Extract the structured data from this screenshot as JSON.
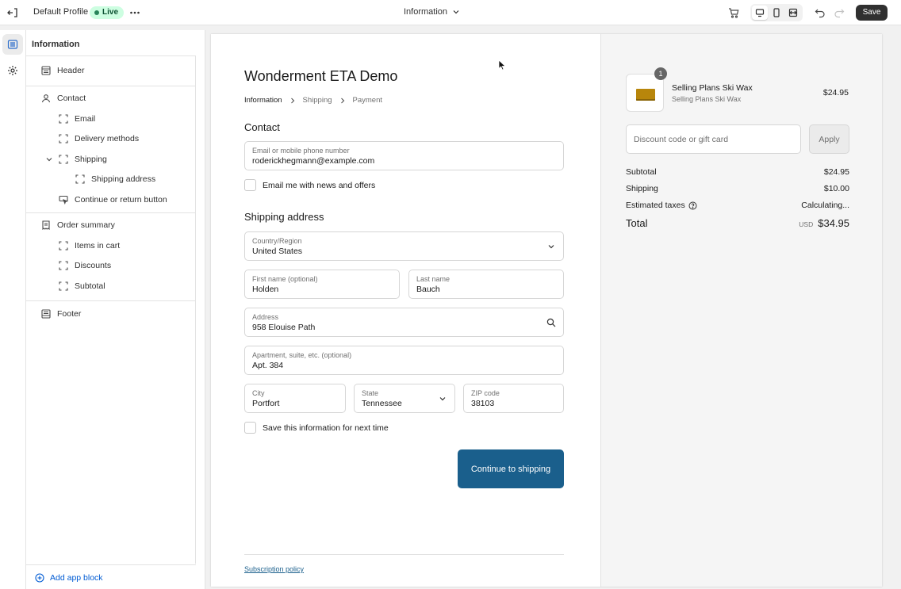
{
  "topbar": {
    "profile_name": "Default Profile",
    "status_badge": "Live",
    "page_selector": "Information",
    "save_label": "Save"
  },
  "sidebar": {
    "title": "Information",
    "items": [
      {
        "label": "Header",
        "icon": "header-layout-icon"
      },
      {
        "label": "Contact",
        "icon": "person-icon"
      },
      {
        "label": "Email",
        "icon": "section-frame-icon"
      },
      {
        "label": "Delivery methods",
        "icon": "section-frame-icon"
      },
      {
        "label": "Shipping",
        "icon": "section-frame-icon"
      },
      {
        "label": "Shipping address",
        "icon": "section-frame-icon"
      },
      {
        "label": "Continue or return button",
        "icon": "button-cursor-icon"
      },
      {
        "label": "Order summary",
        "icon": "receipt-icon"
      },
      {
        "label": "Items in cart",
        "icon": "section-frame-icon"
      },
      {
        "label": "Discounts",
        "icon": "section-frame-icon"
      },
      {
        "label": "Subtotal",
        "icon": "section-frame-icon"
      },
      {
        "label": "Footer",
        "icon": "footer-layout-icon"
      }
    ],
    "add_block_label": "Add app block"
  },
  "checkout": {
    "store_name": "Wonderment ETA Demo",
    "breadcrumbs": [
      "Information",
      "Shipping",
      "Payment"
    ],
    "contact_title": "Contact",
    "email_label": "Email or mobile phone number",
    "email_value": "roderickhegmann@example.com",
    "newsletter_label": "Email me with news and offers",
    "shipping_title": "Shipping address",
    "country_label": "Country/Region",
    "country_value": "United States",
    "first_name_label": "First name (optional)",
    "first_name_value": "Holden",
    "last_name_label": "Last name",
    "last_name_value": "Bauch",
    "address_label": "Address",
    "address_value": "958 Elouise Path",
    "apartment_label": "Apartment, suite, etc. (optional)",
    "apartment_value": "Apt. 384",
    "city_label": "City",
    "city_value": "Portfort",
    "state_label": "State",
    "state_value": "Tennessee",
    "zip_label": "ZIP code",
    "zip_value": "38103",
    "save_info_label": "Save this information for next time",
    "continue_label": "Continue to shipping",
    "policy_link": "Subscription policy"
  },
  "summary": {
    "product_name": "Selling Plans Ski Wax",
    "product_variant": "Selling Plans Ski Wax",
    "product_price": "$24.95",
    "quantity": "1",
    "discount_placeholder": "Discount code or gift card",
    "apply_label": "Apply",
    "subtotal_label": "Subtotal",
    "subtotal_value": "$24.95",
    "shipping_label": "Shipping",
    "shipping_value": "$10.00",
    "taxes_label": "Estimated taxes",
    "taxes_value": "Calculating...",
    "total_label": "Total",
    "currency": "USD",
    "total_value": "$34.95"
  },
  "colors": {
    "primary_button": "#1a5f8c",
    "live_badge_bg": "#cdfee1",
    "save_button_bg": "#303030"
  }
}
